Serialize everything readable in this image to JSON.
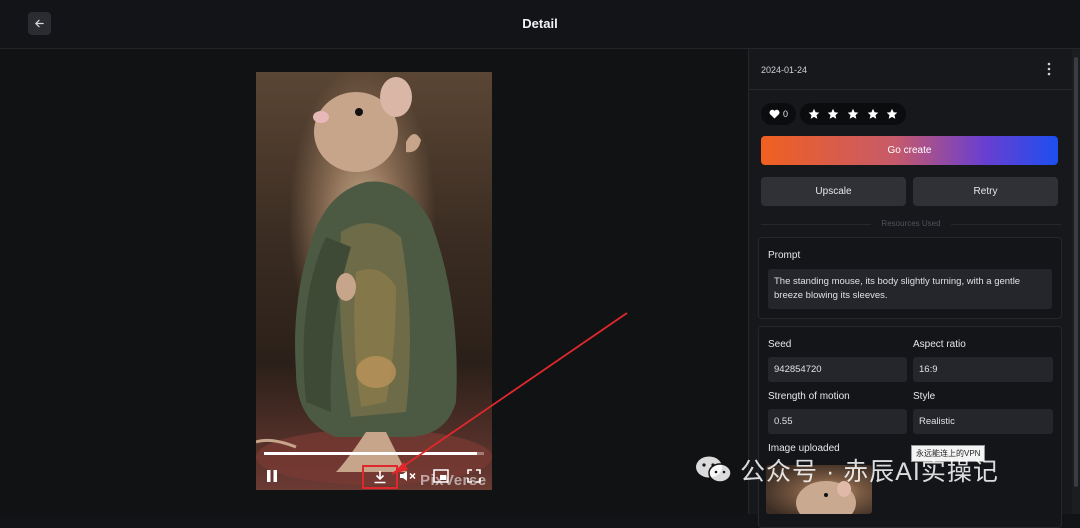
{
  "header": {
    "title": "Detail"
  },
  "video": {
    "watermark": "PixVerse",
    "progress": 0.97
  },
  "sidebar": {
    "date": "2024-01-24",
    "like_count": "0",
    "rating_stars": 5,
    "go_create_label": "Go create",
    "upscale_label": "Upscale",
    "retry_label": "Retry",
    "resources_label": "Resources Used",
    "prompt_label": "Prompt",
    "prompt_text": "The standing mouse, its body slightly turning, with a gentle breeze blowing its sleeves.",
    "seed_label": "Seed",
    "seed_value": "942854720",
    "aspect_label": "Aspect ratio",
    "aspect_value": "16:9",
    "motion_label": "Strength of motion",
    "motion_value": "0.55",
    "style_label": "Style",
    "style_value": "Realistic",
    "image_label": "Image uploaded"
  },
  "tooltip": "永远能连上的VPN",
  "overlay": {
    "wechat_text": "公众号 · 赤辰AI实操记"
  },
  "colors": {
    "accent_start": "#f06020",
    "accent_end": "#1d4ef0",
    "highlight": "#e0282c"
  }
}
